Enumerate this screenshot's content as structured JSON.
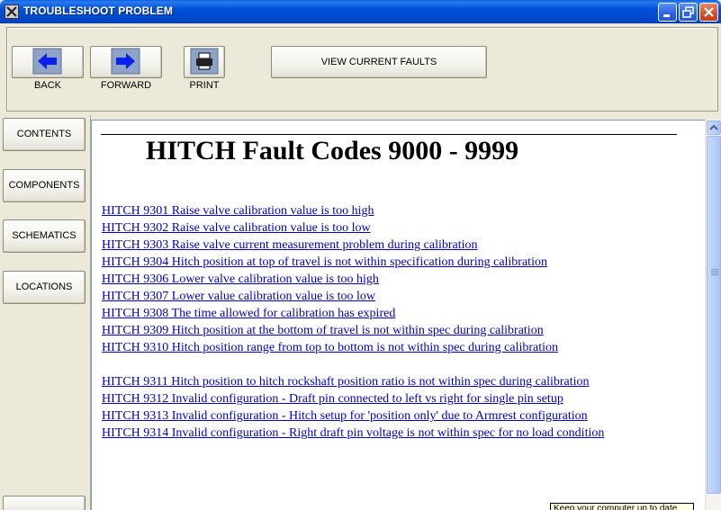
{
  "window": {
    "title": "TROUBLESHOOT PROBLEM",
    "icons": {
      "app": "tools-icon",
      "minimize": "minimize-icon",
      "maximize": "restore-icon",
      "close": "close-icon"
    }
  },
  "toolbar": {
    "back_label": "BACK",
    "forward_label": "FORWARD",
    "print_label": "PRINT",
    "view_faults_label": "VIEW CURRENT FAULTS"
  },
  "sidebar": {
    "items": [
      {
        "label": "CONTENTS"
      },
      {
        "label": "COMPONENTS"
      },
      {
        "label": "SCHEMATICS"
      },
      {
        "label": "LOCATIONS"
      }
    ]
  },
  "content": {
    "title": "HITCH Fault Codes 9000 - 9999",
    "faults": [
      "HITCH 9301 Raise valve calibration value is too high",
      "HITCH 9302 Raise valve calibration value is too low",
      "HITCH 9303 Raise valve current measurement problem during calibration",
      "HITCH 9304 Hitch position at top of travel is not within specification during calibration",
      "HITCH 9306 Lower valve calibration value is too high",
      "HITCH 9307 Lower value calibration value is too low",
      "HITCH 9308 The time allowed for calibration has expired",
      "HITCH 9309 Hitch position at the bottom of travel is not within spec during calibration",
      "HITCH 9310 Hitch position range from top to bottom is not within spec during calibration",
      "HITCH 9311 Hitch position to hitch rockshaft position ratio is not within spec during calibration",
      "HITCH 9312 Invalid configuration - Draft pin connected to left vs right for single pin setup",
      "HITCH 9313 Invalid configuration - Hitch setup for 'position only' due to Armrest configuration",
      "HITCH 9314 Invalid configuration - Right draft pin voltage is not within spec for no load condition"
    ]
  },
  "tooltip": {
    "text": "Keep your computer up to date"
  },
  "colors": {
    "title_bar": "#0050d8",
    "link": "#0000cc",
    "arrow": "#0a22e8",
    "window_bg": "#ece9d8"
  }
}
